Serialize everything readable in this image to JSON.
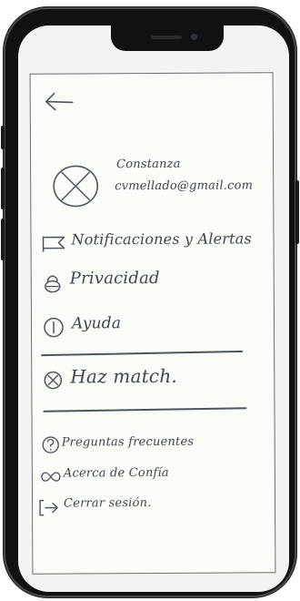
{
  "profile": {
    "name": "Constanza",
    "email": "cvmellado@gmail.com"
  },
  "menu": {
    "notifications": "Notificaciones y Alertas",
    "privacy": "Privacidad",
    "help": "Ayuda",
    "match": "Haz match.",
    "faq": "Preguntas frecuentes",
    "about": "Acerca de Confía",
    "logout": "Cerrar sesión."
  },
  "icons": {
    "back": "arrow-left-icon",
    "avatar": "x-circle-avatar-icon",
    "notifications": "flag-icon",
    "privacy": "lock-icon",
    "help": "info-circle-icon",
    "match": "x-circle-icon",
    "faq": "question-circle-icon",
    "about": "infinity-icon",
    "logout": "exit-arrow-icon"
  },
  "colors": {
    "ink": "#3d4654",
    "phone": "#111111",
    "paper": "#fbfbf8"
  }
}
